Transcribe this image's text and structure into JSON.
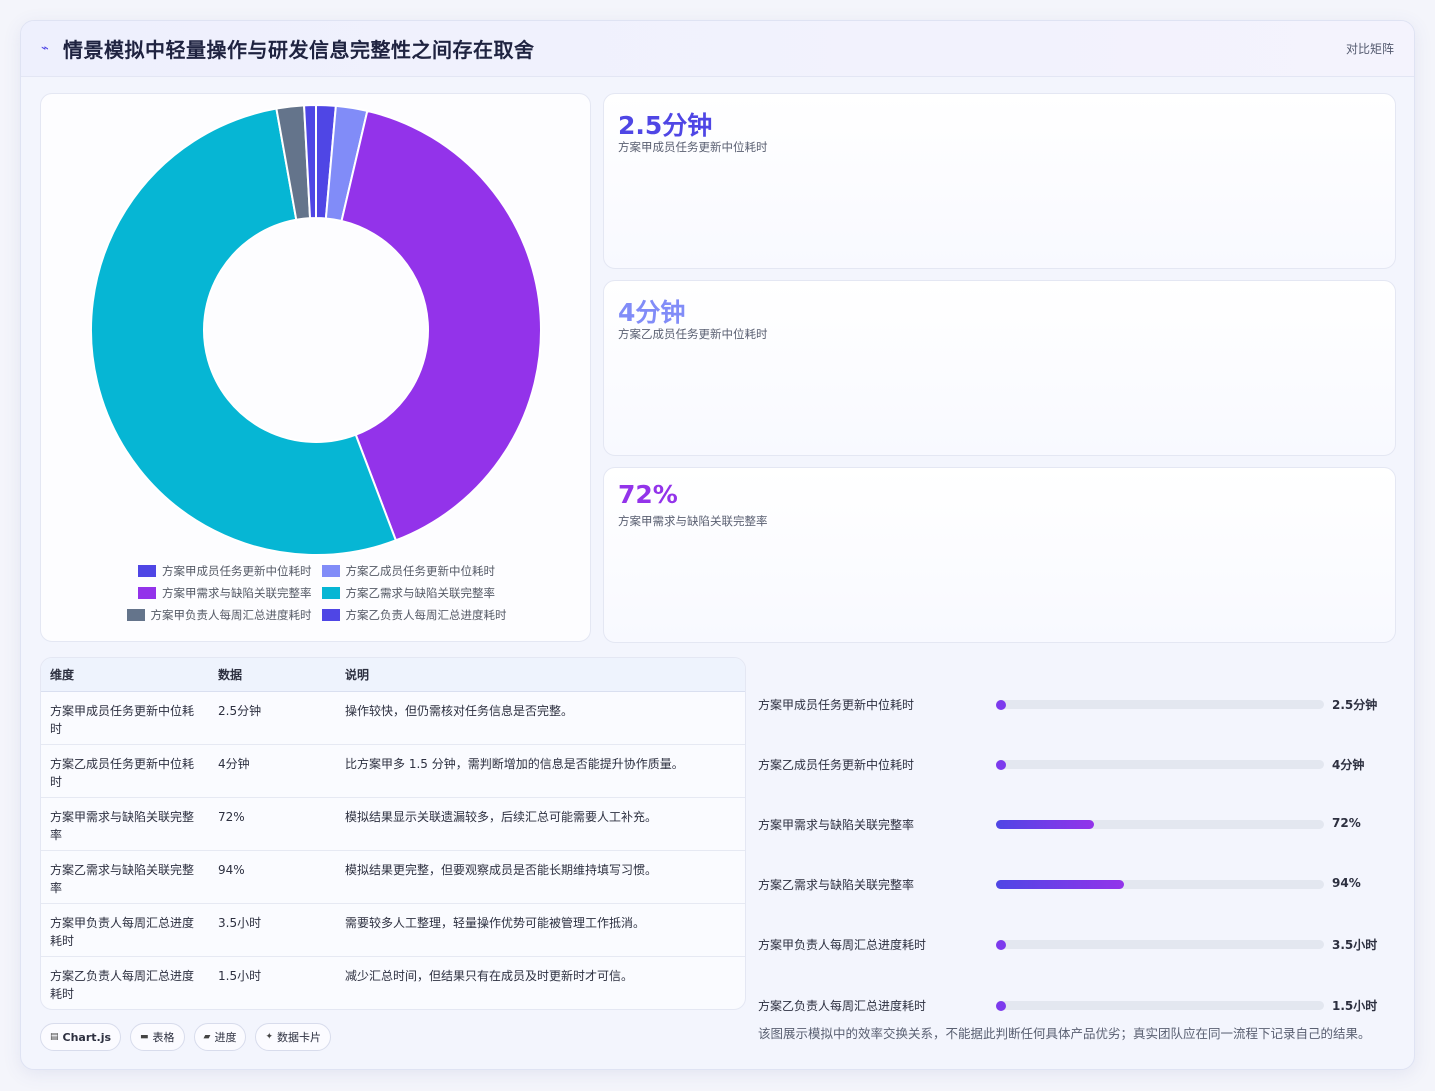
{
  "header": {
    "icon": "trend-icon",
    "title": "情景模拟中轻量操作与研发信息完整性之间存在取舍",
    "view_label": "对比矩阵"
  },
  "chart_data": {
    "type": "pie",
    "variant": "donut",
    "categories": [
      "方案甲成员任务更新中位耗时",
      "方案乙成员任务更新中位耗时",
      "方案甲需求与缺陷关联完整率",
      "方案乙需求与缺陷关联完整率",
      "方案甲负责人每周汇总进度耗时",
      "方案乙负责人每周汇总进度耗时"
    ],
    "values": [
      2.5,
      4,
      72,
      94,
      3.5,
      1.5
    ],
    "colors": [
      "#4f46e5",
      "#818cf8",
      "#9333ea",
      "#06b6d4",
      "#64748b",
      "#4f46e5"
    ],
    "legend_position": "bottom"
  },
  "stats": [
    {
      "value": "2.5分钟",
      "label": "方案甲成员任务更新中位耗时",
      "color": "#4f46e5"
    },
    {
      "value": "4分钟",
      "label": "方案乙成员任务更新中位耗时",
      "color": "#818cf8"
    },
    {
      "value": "72%",
      "label": "方案甲需求与缺陷关联完整率",
      "color": "#9333ea"
    }
  ],
  "table": {
    "headers": [
      "维度",
      "数据",
      "说明"
    ],
    "rows": [
      {
        "dim": "方案甲成员任务更新中位耗时",
        "data": "2.5分钟",
        "note": "操作较快，但仍需核对任务信息是否完整。"
      },
      {
        "dim": "方案乙成员任务更新中位耗时",
        "data": "4分钟",
        "note": "比方案甲多 1.5 分钟，需判断增加的信息是否能提升协作质量。"
      },
      {
        "dim": "方案甲需求与缺陷关联完整率",
        "data": "72%",
        "note": "模拟结果显示关联遗漏较多，后续汇总可能需要人工补充。"
      },
      {
        "dim": "方案乙需求与缺陷关联完整率",
        "data": "94%",
        "note": "模拟结果更完整，但要观察成员是否能长期维持填写习惯。"
      },
      {
        "dim": "方案甲负责人每周汇总进度耗时",
        "data": "3.5小时",
        "note": "需要较多人工整理，轻量操作优势可能被管理工作抵消。"
      },
      {
        "dim": "方案乙负责人每周汇总进度耗时",
        "data": "1.5小时",
        "note": "减少汇总时间，但结果只有在成员及时更新时才可信。"
      }
    ]
  },
  "progress": [
    {
      "label": "方案甲成员任务更新中位耗时",
      "value": "2.5分钟",
      "fraction": 0.0
    },
    {
      "label": "方案乙成员任务更新中位耗时",
      "value": "4分钟",
      "fraction": 0.0
    },
    {
      "label": "方案甲需求与缺陷关联完整率",
      "value": "72%",
      "fraction": 0.3
    },
    {
      "label": "方案乙需求与缺陷关联完整率",
      "value": "94%",
      "fraction": 0.39
    },
    {
      "label": "方案甲负责人每周汇总进度耗时",
      "value": "3.5小时",
      "fraction": 0.0
    },
    {
      "label": "方案乙负责人每周汇总进度耗时",
      "value": "1.5小时",
      "fraction": 0.0
    }
  ],
  "chips": [
    {
      "icon": "chart-icon",
      "label": "Chart.js"
    },
    {
      "icon": "table-icon",
      "label": "表格"
    },
    {
      "icon": "progress-icon",
      "label": "进度"
    },
    {
      "icon": "card-icon",
      "label": "数据卡片"
    }
  ],
  "footnote": "该图展示模拟中的效率交换关系，不能据此判断任何具体产品优劣；真实团队应在同一流程下记录自己的结果。"
}
